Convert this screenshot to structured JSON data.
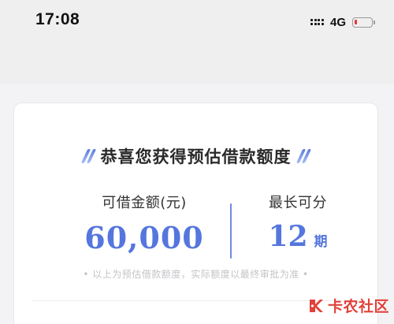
{
  "status_bar": {
    "time": "17:08",
    "network": "4G",
    "battery_color": "#e53935"
  },
  "card": {
    "title": "恭喜您获得预估借款额度",
    "amount_label": "可借金额(元)",
    "amount_value": "60,000",
    "term_label": "最长可分",
    "term_value": "12",
    "term_unit": "期",
    "disclaimer": "• 以上为预估借款额度，实际额度以最终审批为准 •"
  },
  "watermark": {
    "text": "卡农社区"
  },
  "colors": {
    "accent": "#5576de",
    "watermark": "#e0312b"
  }
}
